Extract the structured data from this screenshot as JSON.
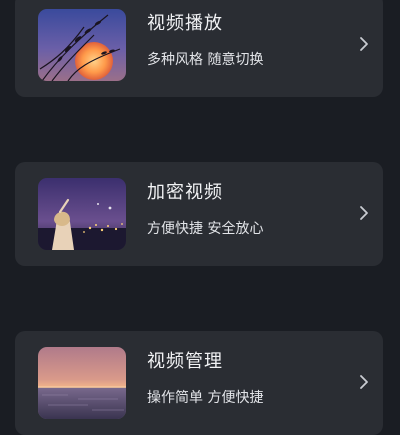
{
  "colors": {
    "page_background": "#1a1d23",
    "card_background": "#2a2d33",
    "title_text": "#f1f2f4",
    "subtitle_text": "#e2e4e8",
    "chevron": "#c9ccd2"
  },
  "cards": [
    {
      "title": "视频播放",
      "subtitle": "多种风格 随意切换",
      "thumbnail_icon": "sunset-reeds-image",
      "chevron_icon": "chevron-right-icon"
    },
    {
      "title": "加密视频",
      "subtitle": "方便快捷 安全放心",
      "thumbnail_icon": "night-city-girl-image",
      "chevron_icon": "chevron-right-icon"
    },
    {
      "title": "视频管理",
      "subtitle": "操作简单 方便快捷",
      "thumbnail_icon": "sea-sunset-image",
      "chevron_icon": "chevron-right-icon"
    }
  ]
}
